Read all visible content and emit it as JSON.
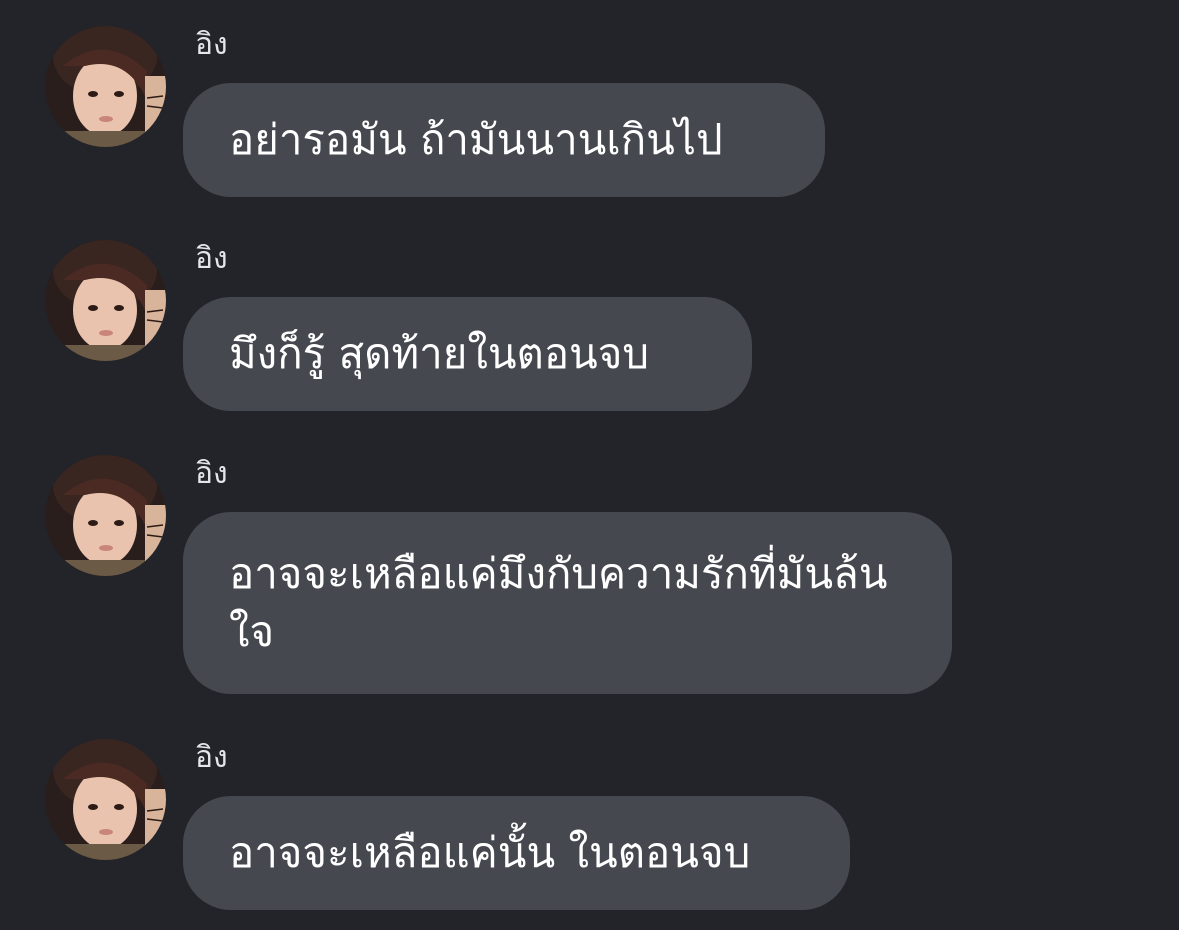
{
  "messages": [
    {
      "sender": "อิง",
      "avatar_icon": "profile-photo",
      "text": "อย่ารอมัน ถ้ามันนานเกินไป"
    },
    {
      "sender": "อิง",
      "avatar_icon": "profile-photo",
      "text": "มึงก็รู้ สุดท้ายในตอนจบ"
    },
    {
      "sender": "อิง",
      "avatar_icon": "profile-photo",
      "text": "อาจจะเหลือแค่มึงกับความรักที่มันล้นใจ"
    },
    {
      "sender": "อิง",
      "avatar_icon": "profile-photo",
      "text": "อาจจะเหลือแค่นั้น ในตอนจบ"
    }
  ],
  "colors": {
    "background": "#23242a",
    "bubble": "#464850",
    "text": "#ffffff",
    "name": "#e4e6eb"
  }
}
